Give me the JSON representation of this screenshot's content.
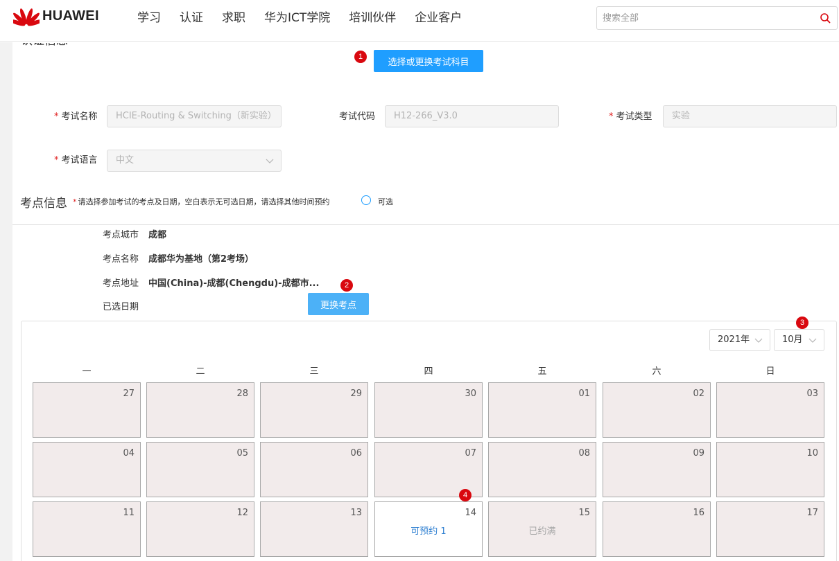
{
  "header": {
    "logo_text": "HUAWEI",
    "nav": [
      "学习",
      "认证",
      "求职",
      "华为ICT学院",
      "培训伙伴",
      "企业客户"
    ],
    "search_placeholder": "搜索全部",
    "accent_color": "#d9080f"
  },
  "certification": {
    "section_title": "认证信息",
    "select_button": "选择或更换考试科目",
    "fields": {
      "exam_name": {
        "label": "考试名称",
        "value": "HCIE-Routing & Switching（新实验）",
        "required": true
      },
      "exam_code": {
        "label": "考试代码",
        "value": "H12-266_V3.0",
        "required": false
      },
      "exam_type": {
        "label": "考试类型",
        "value": "实验",
        "required": true
      },
      "exam_language": {
        "label": "考试语言",
        "value": "中文",
        "required": true
      }
    }
  },
  "site": {
    "section_title": "考点信息",
    "hint": "请选择参加考试的考点及日期，空白表示无可选日期，请选择其他时间预约",
    "legend_label": "可选",
    "city_label": "考点城市",
    "city_value": "成都",
    "name_label": "考点名称",
    "name_value": "成都华为基地（第2考场）",
    "address_label": "考点地址",
    "address_value": "中国(China)-成都(Chengdu)-成都市...",
    "date_label": "已选日期",
    "change_button": "更换考点"
  },
  "calendar": {
    "year_select": "2021年",
    "month_select": "10月",
    "weekdays": [
      "一",
      "二",
      "三",
      "四",
      "五",
      "六",
      "日"
    ],
    "weeks": [
      [
        {
          "day": "27"
        },
        {
          "day": "28"
        },
        {
          "day": "29"
        },
        {
          "day": "30"
        },
        {
          "day": "01"
        },
        {
          "day": "02"
        },
        {
          "day": "03"
        }
      ],
      [
        {
          "day": "04"
        },
        {
          "day": "05"
        },
        {
          "day": "06"
        },
        {
          "day": "07"
        },
        {
          "day": "08"
        },
        {
          "day": "09"
        },
        {
          "day": "10"
        }
      ],
      [
        {
          "day": "11"
        },
        {
          "day": "12"
        },
        {
          "day": "13"
        },
        {
          "day": "14",
          "status": "可预约 1",
          "state": "available"
        },
        {
          "day": "15",
          "status": "已约满",
          "state": "full"
        },
        {
          "day": "16"
        },
        {
          "day": "17"
        }
      ]
    ]
  },
  "badges": [
    "1",
    "2",
    "3",
    "4"
  ]
}
